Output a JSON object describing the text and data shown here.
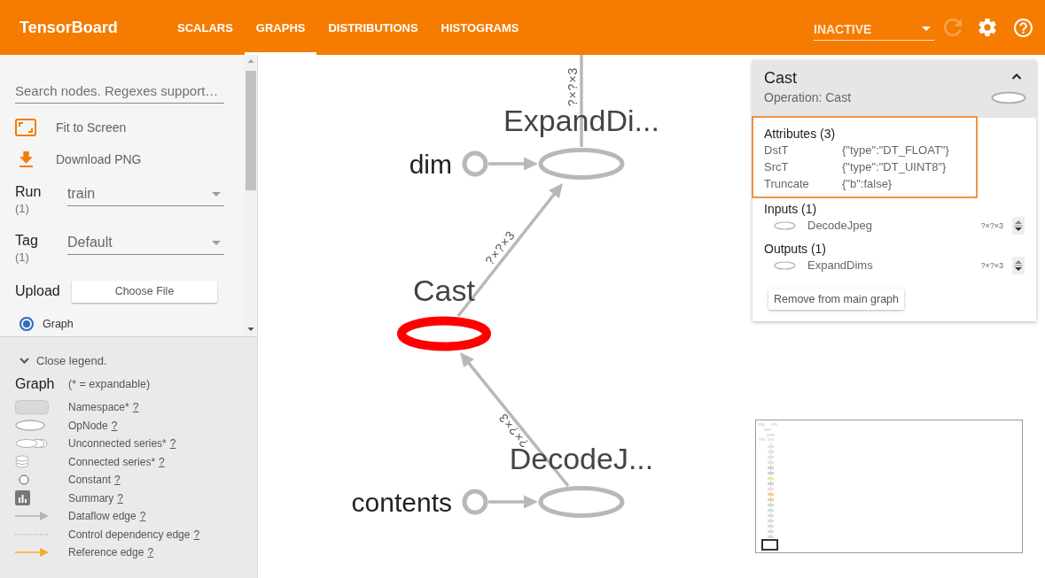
{
  "header": {
    "title": "TensorBoard",
    "tabs": [
      {
        "label": "SCALARS",
        "selected": false
      },
      {
        "label": "GRAPHS",
        "selected": true
      },
      {
        "label": "DISTRIBUTIONS",
        "selected": false
      },
      {
        "label": "HISTOGRAMS",
        "selected": false
      }
    ],
    "run_status": "INACTIVE",
    "reload_disabled": true
  },
  "sidebar": {
    "search": {
      "placeholder": "Search nodes. Regexes support…"
    },
    "actions": [
      {
        "kind": "fit",
        "label": "Fit to Screen"
      },
      {
        "kind": "download",
        "label": "Download PNG"
      }
    ],
    "selectors": [
      {
        "label": "Run",
        "count": "(1)",
        "value": "train"
      },
      {
        "label": "Tag",
        "count": "(1)",
        "value": "Default"
      }
    ],
    "upload": {
      "label": "Upload",
      "button": "Choose File"
    },
    "modes": [
      {
        "label": "Graph",
        "selected": true
      }
    ]
  },
  "legend": {
    "toggle": "Close legend.",
    "title": "Graph",
    "note": "(* = expandable)",
    "items": [
      {
        "kind": "namespace",
        "label": "Namespace*",
        "help": "?"
      },
      {
        "kind": "opnode",
        "label": "OpNode",
        "help": "?"
      },
      {
        "kind": "unconnected",
        "label": "Unconnected series*",
        "help": "?"
      },
      {
        "kind": "connected",
        "label": "Connected series*",
        "help": "?"
      },
      {
        "kind": "constant",
        "label": "Constant",
        "help": "?"
      },
      {
        "kind": "summary",
        "label": "Summary",
        "help": "?"
      },
      {
        "kind": "dataflow",
        "label": "Dataflow edge",
        "help": "?"
      },
      {
        "kind": "control",
        "label": "Control dependency edge",
        "help": "?"
      },
      {
        "kind": "reference",
        "label": "Reference edge",
        "help": "?"
      }
    ]
  },
  "graph": {
    "nodes": [
      {
        "kind": "op",
        "label": "ExpandDi...",
        "selected": false
      },
      {
        "kind": "constant",
        "label": "dim",
        "selected": false
      },
      {
        "kind": "op",
        "label": "Cast",
        "selected": true
      },
      {
        "kind": "op",
        "label": "DecodeJ...",
        "selected": false
      },
      {
        "kind": "constant",
        "label": "contents",
        "selected": false
      }
    ],
    "edges": [
      {
        "label": "?×?×3"
      },
      {
        "label": "?×?×3"
      },
      {
        "label": "?×?×3"
      }
    ]
  },
  "node_info": {
    "title": "Cast",
    "subtitle": "Operation: Cast",
    "expanded": true,
    "attributes": {
      "heading": "Attributes (3)",
      "highlighted": true,
      "items": [
        {
          "name": "DstT",
          "value": "{\"type\":\"DT_FLOAT\"}"
        },
        {
          "name": "SrcT",
          "value": "{\"type\":\"DT_UINT8\"}"
        },
        {
          "name": "Truncate",
          "value": "{\"b\":false}"
        }
      ]
    },
    "inputs": {
      "heading": "Inputs (1)",
      "items": [
        {
          "name": "DecodeJpeg",
          "shape": "?×?×3"
        }
      ]
    },
    "outputs": {
      "heading": "Outputs (1)",
      "items": [
        {
          "name": "ExpandDims",
          "shape": "?×?×3"
        }
      ]
    },
    "remove_button": "Remove from main graph"
  }
}
